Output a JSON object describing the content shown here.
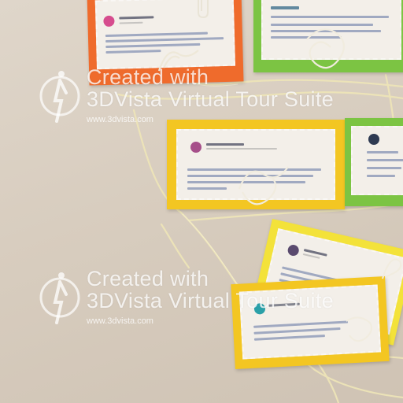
{
  "watermarks": [
    {
      "line1": "Created with",
      "line2": "3DVista Virtual Tour Suite",
      "url": "www.3dvista.com"
    },
    {
      "line1": "Created with",
      "line2": "3DVista Virtual Tour Suite",
      "url": "www.3dvista.com"
    }
  ],
  "colors": {
    "wall": "#d9cfc2",
    "orange": "#ef6b2c",
    "green": "#7cc443",
    "yellow": "#f3c622",
    "twine": "#efe6b8",
    "clip": "#e9e4d6"
  },
  "cards": [
    {
      "id": "orange-card",
      "frame": "orange"
    },
    {
      "id": "green-card-top",
      "frame": "green"
    },
    {
      "id": "yellow-card-middle",
      "frame": "yellow"
    },
    {
      "id": "green-card-right",
      "frame": "green"
    },
    {
      "id": "yellow-card-tilted",
      "frame": "yellow"
    },
    {
      "id": "yellow-card-bottom",
      "frame": "yellow"
    }
  ]
}
